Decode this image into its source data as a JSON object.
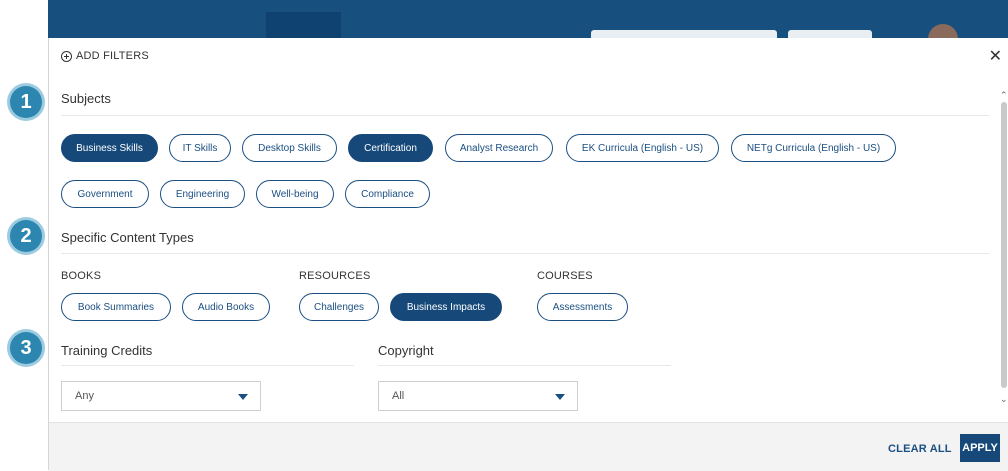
{
  "header": {
    "add_filters_label": "ADD FILTERS",
    "close_icon": "close-icon",
    "plus_icon": "plus-circle-icon"
  },
  "badges": [
    "1",
    "2",
    "3"
  ],
  "subjects": {
    "title": "Subjects",
    "chips": [
      {
        "label": "Business Skills",
        "selected": true
      },
      {
        "label": "IT Skills",
        "selected": false
      },
      {
        "label": "Desktop Skills",
        "selected": false
      },
      {
        "label": "Certification",
        "selected": true
      },
      {
        "label": "Analyst Research",
        "selected": false
      },
      {
        "label": "EK Curricula (English - US)",
        "selected": false
      },
      {
        "label": "NETg Curricula (English - US)",
        "selected": false
      },
      {
        "label": "Government",
        "selected": false
      },
      {
        "label": "Engineering",
        "selected": false
      },
      {
        "label": "Well-being",
        "selected": false
      },
      {
        "label": "Compliance",
        "selected": false
      }
    ]
  },
  "content_types": {
    "title": "Specific Content Types",
    "groups": [
      {
        "label": "BOOKS",
        "chips": [
          {
            "label": "Book Summaries",
            "selected": false
          },
          {
            "label": "Audio Books",
            "selected": false
          }
        ]
      },
      {
        "label": "RESOURCES",
        "chips": [
          {
            "label": "Challenges",
            "selected": false
          },
          {
            "label": "Business Impacts",
            "selected": true
          }
        ]
      },
      {
        "label": "COURSES",
        "chips": [
          {
            "label": "Assessments",
            "selected": false
          }
        ]
      }
    ]
  },
  "training_credits": {
    "title": "Training Credits",
    "value": "Any"
  },
  "copyright": {
    "title": "Copyright",
    "value": "All"
  },
  "footer": {
    "clear_all": "CLEAR ALL",
    "apply": "APPLY"
  },
  "colors": {
    "primary": "#16497a",
    "badge": "#2c86b0",
    "topbar": "#17507f"
  }
}
